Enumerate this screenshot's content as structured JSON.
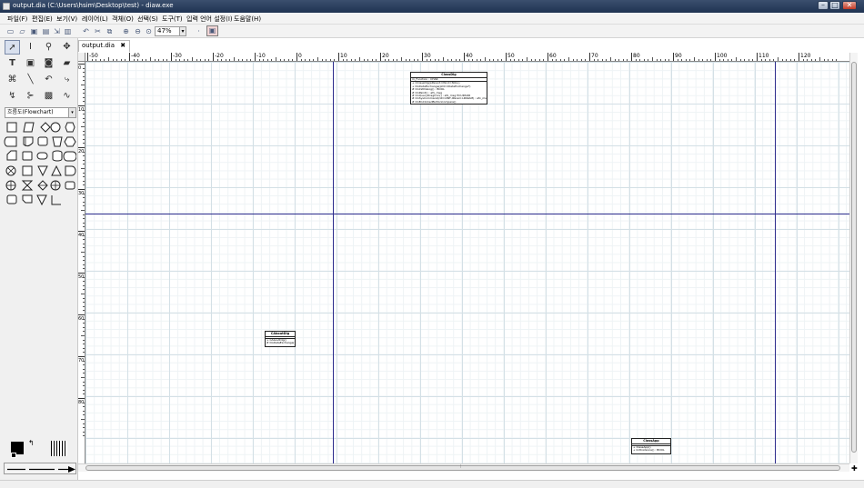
{
  "window": {
    "title": "output.dia (C:\\Users\\hsim\\Desktop\\test) - diaw.exe",
    "buttons": {
      "minimize": "–",
      "maximize": "□",
      "close": "✕"
    }
  },
  "menubar": {
    "items": [
      "파일(F)",
      "편집(E)",
      "보기(V)",
      "레이어(L)",
      "객체(O)",
      "선택(S)",
      "도구(T)",
      "입력 언어 설정(I)",
      "도움말(H)"
    ]
  },
  "toolbar": {
    "zoom_value": "47%",
    "icons": [
      "new-icon",
      "open-icon",
      "save-icon",
      "save-as-icon",
      "export-icon",
      "print-icon",
      "undo-icon",
      "cut-icon",
      "copy-icon",
      "zoom-in-icon",
      "zoom-out-icon",
      "zoom-fit-icon",
      "snap-icon",
      "grid-icon"
    ]
  },
  "toolbox": {
    "sheet_name": "흐름도(Flowchart)"
  },
  "tabs": [
    {
      "label": "output.dia",
      "close": "✖"
    }
  ],
  "ruler": {
    "h_labels": [
      "-50",
      "-40",
      "-30",
      "-20",
      "-10",
      "0",
      "10",
      "20",
      "30",
      "40",
      "50",
      "60",
      "70",
      "80",
      "90",
      "100",
      "110",
      "120"
    ],
    "v_labels": [
      "0",
      "10",
      "20",
      "30",
      "40",
      "50",
      "60",
      "70",
      "80"
    ]
  },
  "canvas": {
    "classes": [
      {
        "name": "ClassDlg",
        "attributes": [
          "m_Function : CHAR"
        ],
        "operations": [
          "+ CClassDlg(pParent:CWnd=NULL)",
          "+ DoDataExchange(pDX:CDataExchange*)",
          "# OnInitDialog() : BOOL",
          "# OnPaint() : afx_msg",
          "# OnQueryDragIcon() : afx_msg HCURSOR",
          "# OnSysCommand(nID:UINT,lParam:LPARAM) : afx_msg",
          "# OnBnClickedButtonCompare()"
        ]
      },
      {
        "name": "CAboutDlg",
        "attributes": [],
        "operations": [
          "+ CAboutDlg()",
          "# DoDataExchange()"
        ]
      },
      {
        "name": "ClassApp",
        "attributes": [],
        "operations": [
          "+ ClassApp()",
          "+ InitInstance() : BOOL"
        ]
      }
    ]
  }
}
